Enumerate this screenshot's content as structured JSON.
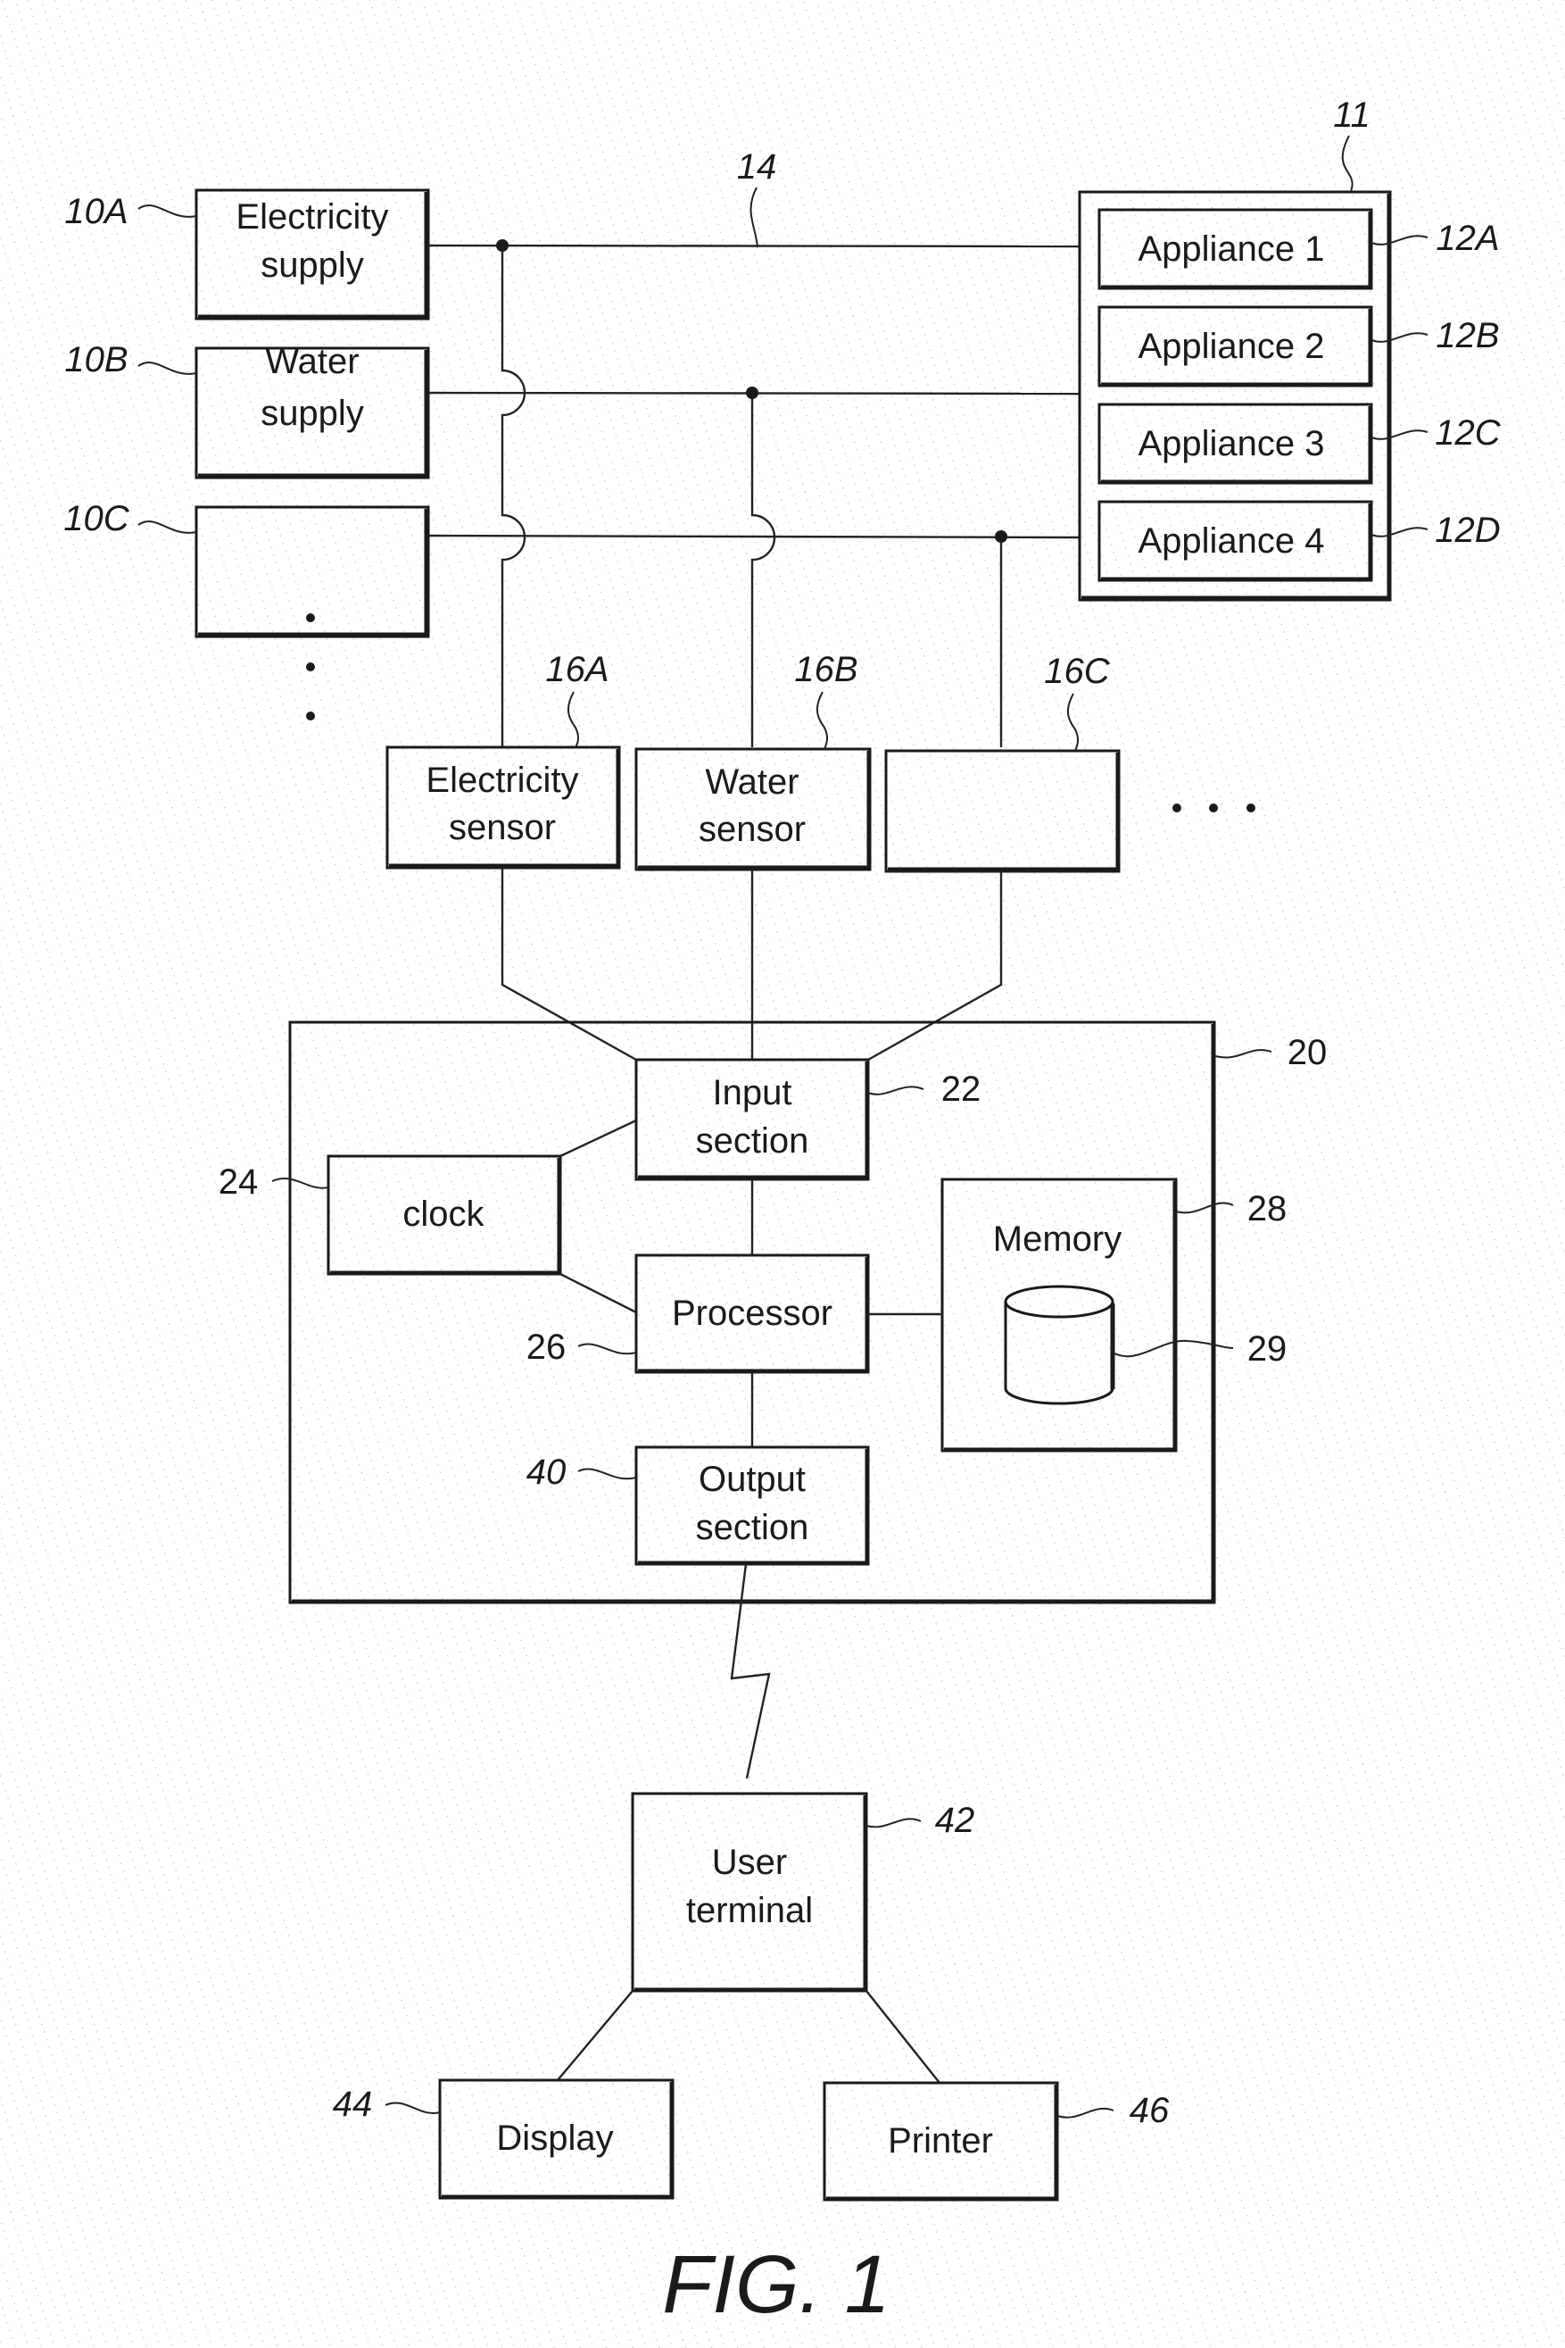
{
  "figure": {
    "caption": "FIG. 1"
  },
  "supplies": [
    {
      "ref": "10A",
      "lines": [
        "Electricity",
        "supply"
      ]
    },
    {
      "ref": "10B",
      "lines": [
        "Water",
        "supply"
      ]
    },
    {
      "ref": "10C",
      "lines": []
    }
  ],
  "appliance_group": {
    "ref": "11",
    "appliances": [
      {
        "ref": "12A",
        "label": "Appliance 1"
      },
      {
        "ref": "12B",
        "label": "Appliance 2"
      },
      {
        "ref": "12C",
        "label": "Appliance 3"
      },
      {
        "ref": "12D",
        "label": "Appliance 4"
      }
    ]
  },
  "supply_line_ref": "14",
  "sensors": [
    {
      "ref": "16A",
      "lines": [
        "Electricity",
        "sensor"
      ]
    },
    {
      "ref": "16B",
      "lines": [
        "Water",
        "sensor"
      ]
    },
    {
      "ref": "16C",
      "lines": []
    }
  ],
  "controller": {
    "ref": "20",
    "input_section": {
      "ref": "22",
      "lines": [
        "Input",
        "section"
      ]
    },
    "clock": {
      "ref": "24",
      "label": "clock"
    },
    "processor": {
      "ref": "26",
      "label": "Processor"
    },
    "memory": {
      "ref": "28",
      "label": "Memory",
      "storage_ref": "29"
    },
    "output_section": {
      "ref": "40",
      "lines": [
        "Output",
        "section"
      ]
    }
  },
  "user_terminal": {
    "ref": "42",
    "lines": [
      "User",
      "terminal"
    ]
  },
  "display": {
    "ref": "44",
    "label": "Display"
  },
  "printer": {
    "ref": "46",
    "label": "Printer"
  }
}
